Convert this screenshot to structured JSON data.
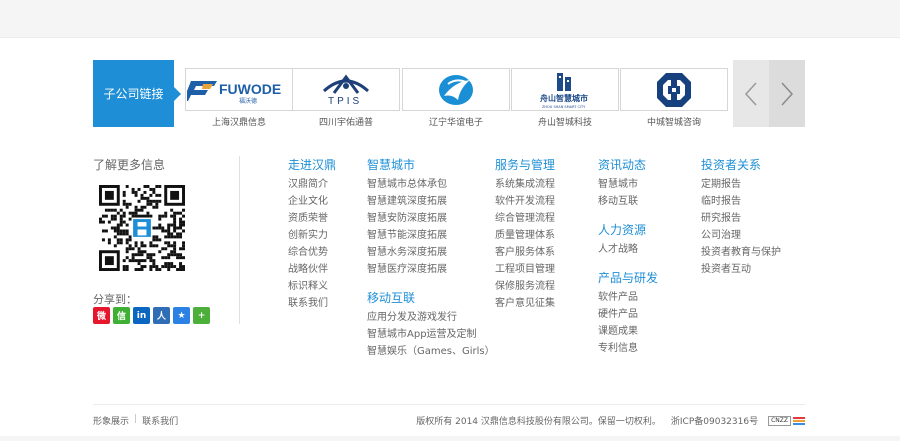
{
  "subsidiaries": {
    "label": "子公司链接",
    "items": [
      {
        "caption": "上海汉鼎信息",
        "logo_text": "FUWODE",
        "logo_sub": "福沃德"
      },
      {
        "caption": "四川宇佑通普",
        "logo_text": "TPIS"
      },
      {
        "caption": "辽宁华谊电子",
        "logo_text": ""
      },
      {
        "caption": "舟山智城科技",
        "logo_text": "舟山智慧城市",
        "logo_sub": "ZHOU SHAN SMART CITY"
      },
      {
        "caption": "中城智城咨询",
        "logo_text": ""
      }
    ],
    "prev_icon": "chevron-left-icon",
    "next_icon": "chevron-right-icon"
  },
  "info": {
    "more_title": "了解更多信息",
    "share_title": "分享到：",
    "share_icons": [
      {
        "name": "weibo-icon",
        "color": "#e6162d",
        "glyph": "微"
      },
      {
        "name": "wechat-icon",
        "color": "#3eb135",
        "glyph": "信"
      },
      {
        "name": "linkedin-icon",
        "color": "#0b66c2",
        "glyph": "in"
      },
      {
        "name": "renren-icon",
        "color": "#2f6db5",
        "glyph": "人"
      },
      {
        "name": "qzone-icon",
        "color": "#2b82e4",
        "glyph": "★"
      },
      {
        "name": "more-share-icon",
        "color": "#4caf3a",
        "glyph": "+"
      }
    ]
  },
  "columns": [
    {
      "title": "走进汉鼎",
      "links": [
        "汉鼎简介",
        "企业文化",
        "资质荣誉",
        "创新实力",
        "综合优势",
        "战略伙伴",
        "标识释义",
        "联系我们"
      ]
    },
    {
      "title": "智慧城市",
      "links": [
        "智慧城市总体承包",
        "智慧建筑深度拓展",
        "智慧安防深度拓展",
        "智慧节能深度拓展",
        "智慧水务深度拓展",
        "智慧医疗深度拓展"
      ],
      "sub_title": "移动互联",
      "sub_links": [
        "应用分发及游戏发行",
        "智慧城市App运营及定制",
        "智慧娱乐（Games、Girls）"
      ]
    },
    {
      "title": "服务与管理",
      "links": [
        "系统集成流程",
        "软件开发流程",
        "综合管理流程",
        "质量管理体系",
        "客户服务体系",
        "工程项目管理",
        "保修服务流程",
        "客户意见征集"
      ]
    },
    {
      "title": "资讯动态",
      "links": [
        "智慧城市",
        "移动互联"
      ],
      "sub_title": "人力资源",
      "sub_links": [
        "人才战略"
      ],
      "sub2_title": "产品与研发",
      "sub2_links": [
        "软件产品",
        "硬件产品",
        "课题成果",
        "专利信息"
      ]
    },
    {
      "title": "投资者关系",
      "links": [
        "定期报告",
        "临时报告",
        "研究报告",
        "公司治理",
        "投资者教育与保护",
        "投资者互动"
      ]
    }
  ],
  "footer": {
    "left_links": [
      "形象展示",
      "联系我们"
    ],
    "copyright": "版权所有  2014 汉鼎信息科技股份有限公司。保留一切权利。",
    "icp": "浙ICP备09032316号",
    "stat_badge": "CNZZ"
  },
  "colors": {
    "accent": "#1e8fd6"
  }
}
